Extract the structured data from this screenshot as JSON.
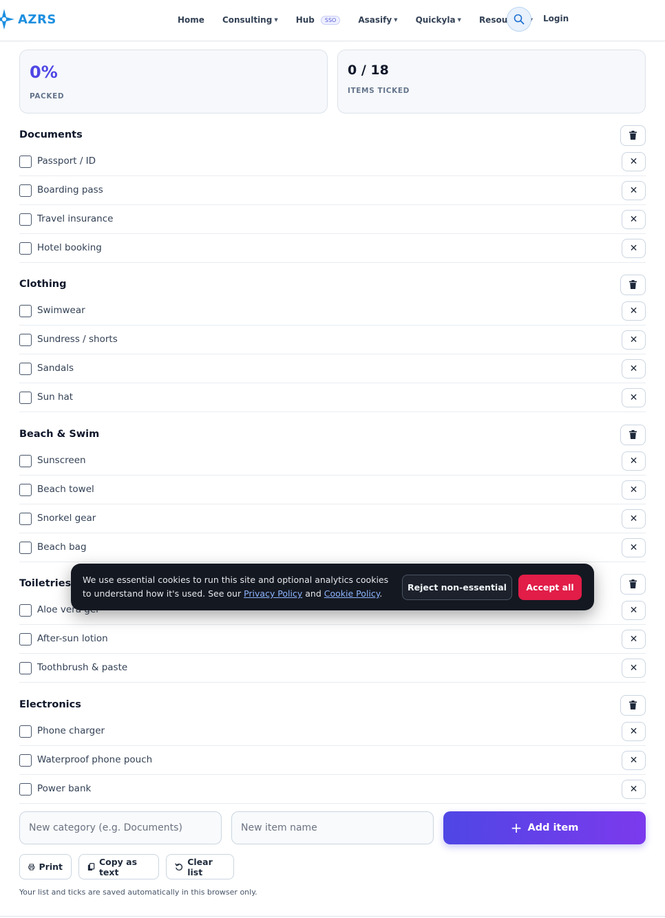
{
  "header": {
    "logo_text": "AZRS",
    "nav": [
      {
        "label": "Home"
      },
      {
        "label": "Consulting"
      },
      {
        "label": "Hub",
        "badge": "SSO"
      },
      {
        "label": "Asasify"
      },
      {
        "label": "Quickyla"
      },
      {
        "label": "Resources"
      }
    ],
    "login": "Login"
  },
  "stats": {
    "packed_value": "0%",
    "packed_label": "PACKED",
    "ticked_value": "0 / 18",
    "ticked_label": "ITEMS TICKED"
  },
  "categories": [
    {
      "name": "Documents",
      "items": [
        {
          "label": "Passport / ID",
          "checked": false
        },
        {
          "label": "Boarding pass",
          "checked": false
        },
        {
          "label": "Travel insurance",
          "checked": false
        },
        {
          "label": "Hotel booking",
          "checked": false
        }
      ]
    },
    {
      "name": "Clothing",
      "items": [
        {
          "label": "Swimwear",
          "checked": false
        },
        {
          "label": "Sundress / shorts",
          "checked": false
        },
        {
          "label": "Sandals",
          "checked": false
        },
        {
          "label": "Sun hat",
          "checked": false
        }
      ]
    },
    {
      "name": "Beach & Swim",
      "items": [
        {
          "label": "Sunscreen",
          "checked": false
        },
        {
          "label": "Beach towel",
          "checked": false
        },
        {
          "label": "Snorkel gear",
          "checked": false
        },
        {
          "label": "Beach bag",
          "checked": false
        }
      ]
    },
    {
      "name": "Toiletries",
      "items": [
        {
          "label": "Aloe vera gel",
          "checked": false
        },
        {
          "label": "After-sun lotion",
          "checked": false
        },
        {
          "label": "Toothbrush & paste",
          "checked": false
        }
      ]
    },
    {
      "name": "Electronics",
      "items": [
        {
          "label": "Phone charger",
          "checked": false
        },
        {
          "label": "Waterproof phone pouch",
          "checked": false
        },
        {
          "label": "Power bank",
          "checked": false
        }
      ]
    }
  ],
  "form": {
    "category_placeholder": "New category (e.g. Documents)",
    "item_placeholder": "New item name",
    "add_label": "Add item"
  },
  "toolbar": {
    "print_label": "Print",
    "copy_label": "Copy as text",
    "clear_label": "Clear list"
  },
  "footnote": "Your list and ticks are saved automatically in this browser only.",
  "cookie": {
    "text_before": "We use essential cookies to run this site and optional analytics cookies to understand how it's used. See our ",
    "privacy_link": "Privacy Policy",
    "text_and": " and ",
    "cookie_link": "Cookie Policy",
    "text_end": ".",
    "reject_label": "Reject non-essential",
    "accept_label": "Accept all"
  },
  "colors": {
    "accent": "#4f46e5",
    "brand": "#1d8fe0",
    "accept": "#e11d48"
  }
}
